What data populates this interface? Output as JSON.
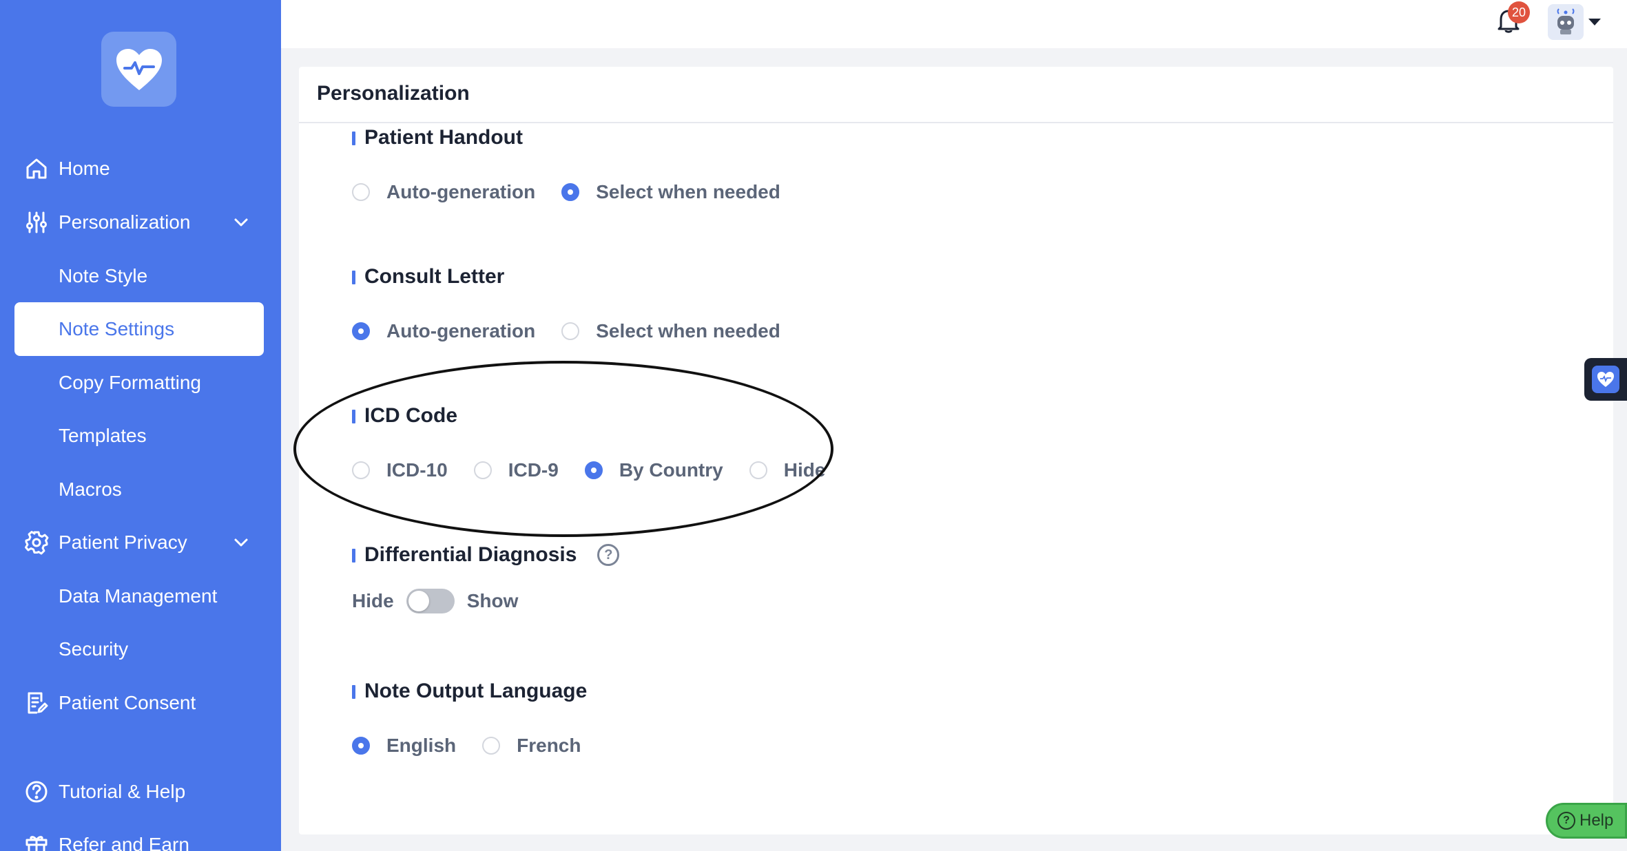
{
  "app": {
    "accent": "#4a76ea",
    "sidebar_bg": "#4a76ea"
  },
  "sidebar": {
    "items": [
      {
        "label": "Home",
        "icon": "home-icon"
      },
      {
        "label": "Personalization",
        "icon": "sliders-icon",
        "expanded": true
      },
      {
        "label": "Note Style"
      },
      {
        "label": "Note Settings",
        "active": true
      },
      {
        "label": "Copy Formatting"
      },
      {
        "label": "Templates"
      },
      {
        "label": "Macros"
      },
      {
        "label": "Patient Privacy",
        "icon": "gear-icon",
        "expanded": true
      },
      {
        "label": "Data Management"
      },
      {
        "label": "Security"
      },
      {
        "label": "Patient Consent",
        "icon": "document-icon"
      },
      {
        "label": "Tutorial & Help",
        "icon": "help-circle-icon"
      },
      {
        "label": "Refer and Earn",
        "icon": "gift-icon"
      }
    ]
  },
  "header": {
    "notification_count": "20"
  },
  "panel": {
    "title": "Personalization",
    "sections": {
      "patient_handout": {
        "title": "Patient Handout",
        "options": [
          "Auto-generation",
          "Select when needed"
        ],
        "selected": "Select when needed"
      },
      "consult_letter": {
        "title": "Consult Letter",
        "options": [
          "Auto-generation",
          "Select when needed"
        ],
        "selected": "Auto-generation"
      },
      "icd_code": {
        "title": "ICD Code",
        "options": [
          "ICD-10",
          "ICD-9",
          "By Country",
          "Hide"
        ],
        "selected": "By Country"
      },
      "differential_diagnosis": {
        "title": "Differential Diagnosis",
        "help_glyph": "?",
        "off_label": "Hide",
        "on_label": "Show",
        "state": "Hide"
      },
      "note_output_language": {
        "title": "Note Output Language",
        "options": [
          "English",
          "French"
        ],
        "selected": "English"
      }
    }
  },
  "help_button": {
    "label": "Help",
    "glyph": "?"
  }
}
